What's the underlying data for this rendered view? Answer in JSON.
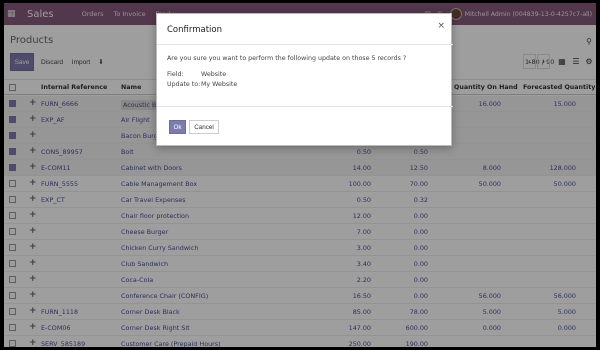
{
  "navbar": {
    "app_name": "Sales",
    "menu": [
      "Orders",
      "To Invoice",
      "Produ"
    ],
    "user": "Mitchell Admin (004839-13-0-4257c7-all)"
  },
  "control": {
    "title": "Products",
    "save": "Save",
    "discard": "Discard",
    "import": "Import",
    "pager": "1-80 / 90"
  },
  "list": {
    "headers": [
      "Internal Reference",
      "Name",
      "Quantity On Hand",
      "Forecasted Quantity"
    ],
    "rows": [
      {
        "ref": "FURN_6666",
        "name": "Acoustic Blo",
        "v1": "",
        "v2": "",
        "qoh": "16.000",
        "fc": "15.000",
        "sel": true
      },
      {
        "ref": "EXP_AF",
        "name": "Air Flight",
        "v1": "",
        "v2": "",
        "qoh": "",
        "fc": "",
        "sel": true
      },
      {
        "ref": "",
        "name": "Bacon Burger",
        "v1": "",
        "v2": "",
        "qoh": "",
        "fc": "",
        "sel": true
      },
      {
        "ref": "CONS_89957",
        "name": "Bolt",
        "v1": "0.50",
        "v2": "0.50",
        "qoh": "",
        "fc": "",
        "sel": true
      },
      {
        "ref": "E-COM11",
        "name": "Cabinet with Doors",
        "v1": "14.00",
        "v2": "12.50",
        "qoh": "8.000",
        "fc": "128.000",
        "sel": true
      },
      {
        "ref": "FURN_5555",
        "name": "Cable Management Box",
        "v1": "100.00",
        "v2": "70.00",
        "qoh": "50.000",
        "fc": "50.000",
        "sel": false
      },
      {
        "ref": "EXP_CT",
        "name": "Car Travel Expenses",
        "v1": "0.50",
        "v2": "0.32",
        "qoh": "",
        "fc": "",
        "sel": false
      },
      {
        "ref": "",
        "name": "Chair floor protection",
        "v1": "12.00",
        "v2": "0.00",
        "qoh": "",
        "fc": "",
        "sel": false
      },
      {
        "ref": "",
        "name": "Cheese Burger",
        "v1": "7.00",
        "v2": "0.00",
        "qoh": "",
        "fc": "",
        "sel": false
      },
      {
        "ref": "",
        "name": "Chicken Curry Sandwich",
        "v1": "3.00",
        "v2": "0.00",
        "qoh": "",
        "fc": "",
        "sel": false
      },
      {
        "ref": "",
        "name": "Club Sandwich",
        "v1": "3.40",
        "v2": "0.00",
        "qoh": "",
        "fc": "",
        "sel": false
      },
      {
        "ref": "",
        "name": "Coca-Cola",
        "v1": "2.20",
        "v2": "0.00",
        "qoh": "",
        "fc": "",
        "sel": false
      },
      {
        "ref": "",
        "name": "Conference Chair (CONFIG)",
        "v1": "16.50",
        "v2": "0.00",
        "qoh": "56.000",
        "fc": "56.000",
        "sel": false
      },
      {
        "ref": "FURN_1118",
        "name": "Corner Desk Black",
        "v1": "85.00",
        "v2": "78.00",
        "qoh": "5.000",
        "fc": "5.000",
        "sel": false
      },
      {
        "ref": "E-COM06",
        "name": "Corner Desk Right Sit",
        "v1": "147.00",
        "v2": "600.00",
        "qoh": "0.000",
        "fc": "0.000",
        "sel": false
      },
      {
        "ref": "SERV_585189",
        "name": "Customer Care (Prepaid Hours)",
        "v1": "250.00",
        "v2": "190.00",
        "qoh": "",
        "fc": "",
        "sel": false
      }
    ]
  },
  "dialog": {
    "title": "Confirmation",
    "close": "×",
    "message": "Are you sure you want to perform the following update on those 5 records ?",
    "field_label": "Field:",
    "field_value": "Website",
    "update_label": "Update to:",
    "update_value": "My Website",
    "ok": "Ok",
    "cancel": "Cancel"
  },
  "colors": {
    "brand": "#875a7b",
    "primary": "#7c7bad"
  }
}
